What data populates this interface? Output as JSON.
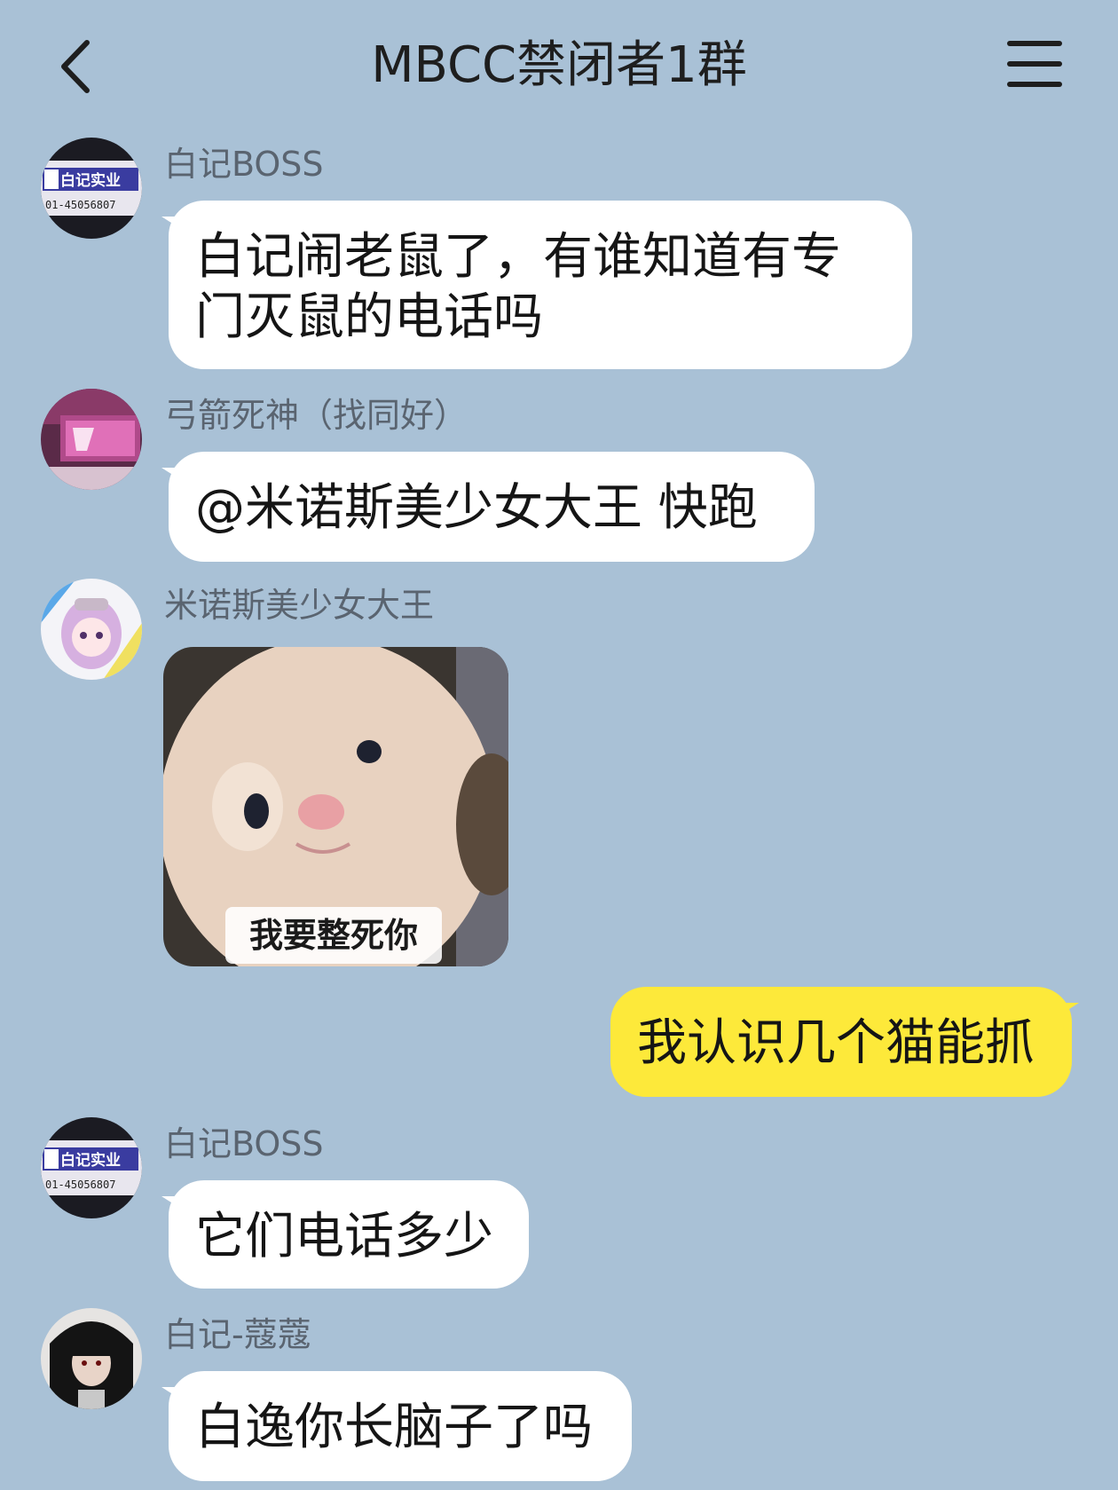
{
  "header": {
    "title": "MBCC禁闭者1群",
    "back_icon": "chevron-left-icon",
    "menu_icon": "hamburger-menu-icon"
  },
  "colors": {
    "background": "#a9c1d6",
    "incoming_bubble": "#ffffff",
    "outgoing_bubble": "#fde93a"
  },
  "messages": [
    {
      "sender": "白记BOSS",
      "text": "白记闹老鼠了，有谁知道有专门灭鼠的电话吗",
      "avatar": "baiji-shiye-sign-avatar"
    },
    {
      "sender": "弓箭死神（找同好）",
      "text": "@米诺斯美少女大王  快跑",
      "avatar": "neon-sign-avatar"
    },
    {
      "sender": "米诺斯美少女大王",
      "sticker_caption": "我要整死你",
      "avatar": "anime-girl-avatar",
      "sticker": "crying-kitten-sticker"
    },
    {
      "mine": true,
      "text": "我认识几个猫能抓"
    },
    {
      "sender": "白记BOSS",
      "text": "它们电话多少",
      "avatar": "baiji-shiye-sign-avatar"
    },
    {
      "sender": "白记-蔻蔻",
      "text": "白逸你长脑子了吗",
      "avatar": "dark-hair-girl-avatar"
    }
  ]
}
